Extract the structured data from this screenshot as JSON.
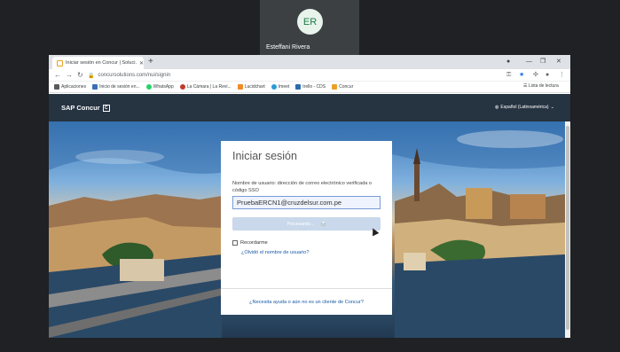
{
  "meeting": {
    "avatar_initials": "ER",
    "participant_name": "Esteffani Rivera"
  },
  "browser": {
    "tab_title": "Iniciar sesión en Concur | Soluci...",
    "url": "concursolutions.com/nui/signin",
    "bookmarks": [
      {
        "label": "Aplicaciones",
        "color": "#5a5a5a"
      },
      {
        "label": "Inicio de sesión en...",
        "color": "#3b6fb6"
      },
      {
        "label": "WhatsApp",
        "color": "#25d366"
      },
      {
        "label": "La Cámara | La Revi...",
        "color": "#c0392b"
      },
      {
        "label": "Lucidchart",
        "color": "#f08a24"
      },
      {
        "label": "Imeet",
        "color": "#2d9bd7"
      },
      {
        "label": "trello - CDS",
        "color": "#2b6cb0"
      },
      {
        "label": "Concur",
        "color": "#e8a128"
      }
    ],
    "reading_list": "Lista de lectura"
  },
  "page": {
    "logo": "SAP Concur",
    "logo_box": "C",
    "language": "Español (Latinoamérica)",
    "signin": {
      "title": "Iniciar sesión",
      "username_label": "Nombre de usuario: dirección de correo electrónico verificada o código SSO",
      "username_value": "PruebaERCN1@cruzdelsur.com.pe",
      "button_label": "Procesando...",
      "remember_label": "Recordarme",
      "forgot_link": "¿Olvidó el nombre de usuario?",
      "help_link": "¿Necesita ayuda o aún no es un cliente de Concur?"
    }
  }
}
